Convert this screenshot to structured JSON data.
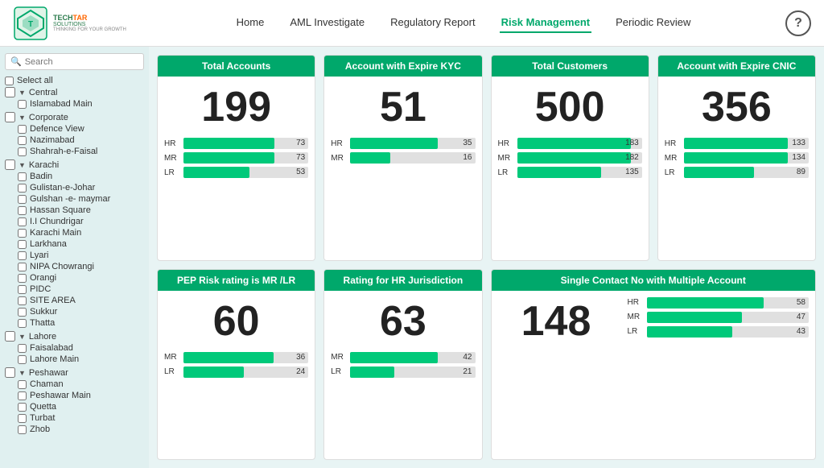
{
  "header": {
    "logo_name": "TECHTAR SOLUTIONS",
    "logo_tagline": "THINKING FOR YOUR GROWTH",
    "nav": [
      {
        "label": "Home",
        "active": false
      },
      {
        "label": "AML Investigate",
        "active": false
      },
      {
        "label": "Regulatory Report",
        "active": false
      },
      {
        "label": "Risk Management",
        "active": true
      },
      {
        "label": "Periodic Review",
        "active": false
      }
    ],
    "help_label": "?"
  },
  "sidebar": {
    "search_placeholder": "Search",
    "select_all": "Select all",
    "groups": [
      {
        "name": "Central",
        "children": [
          "Islamabad Main"
        ]
      },
      {
        "name": "Corporate",
        "children": [
          "Defence View",
          "Nazimabad",
          "Shahrah-e-Faisal"
        ]
      },
      {
        "name": "Karachi",
        "children": [
          "Badin",
          "Gulistan-e-Johar",
          "Gulshan -e- maymar",
          "Hassan Square",
          "I.I Chundrigar",
          "Karachi Main",
          "Larkhana",
          "Lyari",
          "NIPA Chowrangi",
          "Orangi",
          "PIDC",
          "SITE AREA",
          "Sukkur",
          "Thatta"
        ]
      },
      {
        "name": "Lahore",
        "children": [
          "Faisalabad",
          "Lahore Main"
        ]
      },
      {
        "name": "Peshawar",
        "children": [
          "Chaman",
          "Peshawar Main",
          "Quetta",
          "Turbat",
          "Zhob"
        ]
      }
    ]
  },
  "cards": {
    "total_accounts": {
      "title": "Total Accounts",
      "value": "199",
      "bars": [
        {
          "label": "HR",
          "value": 73,
          "max": 100,
          "display": "73"
        },
        {
          "label": "MR",
          "value": 73,
          "max": 100,
          "display": "73"
        },
        {
          "label": "LR",
          "value": 53,
          "max": 100,
          "display": "53"
        }
      ]
    },
    "account_expire_kyc": {
      "title": "Account with Expire KYC",
      "value": "51",
      "bars": [
        {
          "label": "HR",
          "value": 35,
          "max": 50,
          "display": "35"
        },
        {
          "label": "MR",
          "value": 16,
          "max": 50,
          "display": "16"
        }
      ]
    },
    "total_customers": {
      "title": "Total Customers",
      "value": "500",
      "bars": [
        {
          "label": "HR",
          "value": 183,
          "max": 200,
          "display": "183"
        },
        {
          "label": "MR",
          "value": 182,
          "max": 200,
          "display": "182"
        },
        {
          "label": "LR",
          "value": 135,
          "max": 200,
          "display": "135"
        }
      ]
    },
    "account_expire_cnic": {
      "title": "Account with Expire CNIC",
      "value": "356",
      "bars": [
        {
          "label": "HR",
          "value": 133,
          "max": 160,
          "display": "133"
        },
        {
          "label": "MR",
          "value": 134,
          "max": 160,
          "display": "134"
        },
        {
          "label": "LR",
          "value": 89,
          "max": 160,
          "display": "89"
        }
      ]
    },
    "pep_risk": {
      "title": "PEP Risk rating is MR /LR",
      "value": "60",
      "bars": [
        {
          "label": "MR",
          "value": 36,
          "max": 50,
          "display": "36"
        },
        {
          "label": "LR",
          "value": 24,
          "max": 50,
          "display": "24"
        }
      ]
    },
    "hr_jurisdiction": {
      "title": "Rating for HR Jurisdiction",
      "value": "63",
      "bars": [
        {
          "label": "MR",
          "value": 42,
          "max": 60,
          "display": "42"
        },
        {
          "label": "LR",
          "value": 21,
          "max": 60,
          "display": "21"
        }
      ]
    },
    "single_contact": {
      "title": "Single Contact No with Multiple Account",
      "value": "148",
      "bars": [
        {
          "label": "HR",
          "value": 58,
          "max": 80,
          "display": "58"
        },
        {
          "label": "MR",
          "value": 47,
          "max": 80,
          "display": "47"
        },
        {
          "label": "LR",
          "value": 43,
          "max": 80,
          "display": "43"
        }
      ]
    }
  }
}
